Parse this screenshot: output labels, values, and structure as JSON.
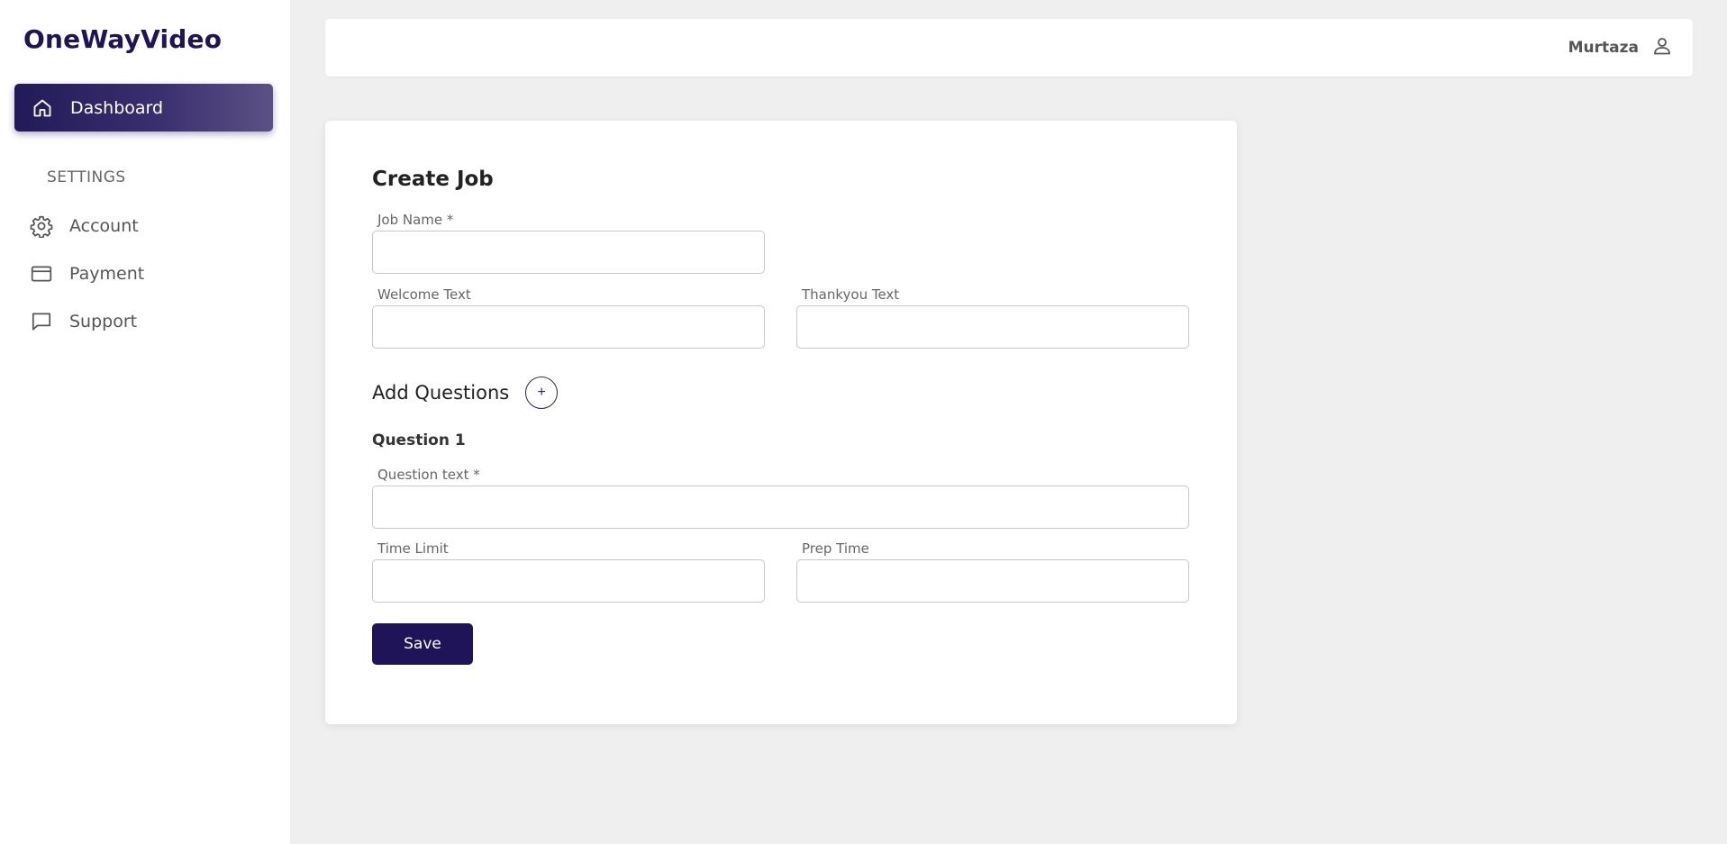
{
  "app": {
    "brand": "OneWayVideo"
  },
  "sidebar": {
    "active_item": {
      "label": "Dashboard",
      "icon": "home-icon"
    },
    "section_label": "SETTINGS",
    "items": [
      {
        "label": "Account",
        "icon": "gear-icon"
      },
      {
        "label": "Payment",
        "icon": "credit-card-icon"
      },
      {
        "label": "Support",
        "icon": "chat-icon"
      }
    ]
  },
  "header": {
    "user_name": "Murtaza",
    "user_icon": "user-icon"
  },
  "form": {
    "title": "Create Job",
    "job_name": {
      "label": "Job Name *",
      "value": ""
    },
    "welcome_text": {
      "label": "Welcome Text",
      "value": ""
    },
    "thankyou_text": {
      "label": "Thankyou Text",
      "value": ""
    },
    "add_questions_label": "Add Questions",
    "add_question_button": "+",
    "question": {
      "title": "Question 1",
      "text": {
        "label": "Question text *",
        "value": ""
      },
      "time_limit": {
        "label": "Time Limit",
        "value": ""
      },
      "prep_time": {
        "label": "Prep Time",
        "value": ""
      }
    },
    "save_label": "Save"
  },
  "colors": {
    "brand": "#1e1457",
    "background": "#efefef",
    "card": "#ffffff"
  }
}
